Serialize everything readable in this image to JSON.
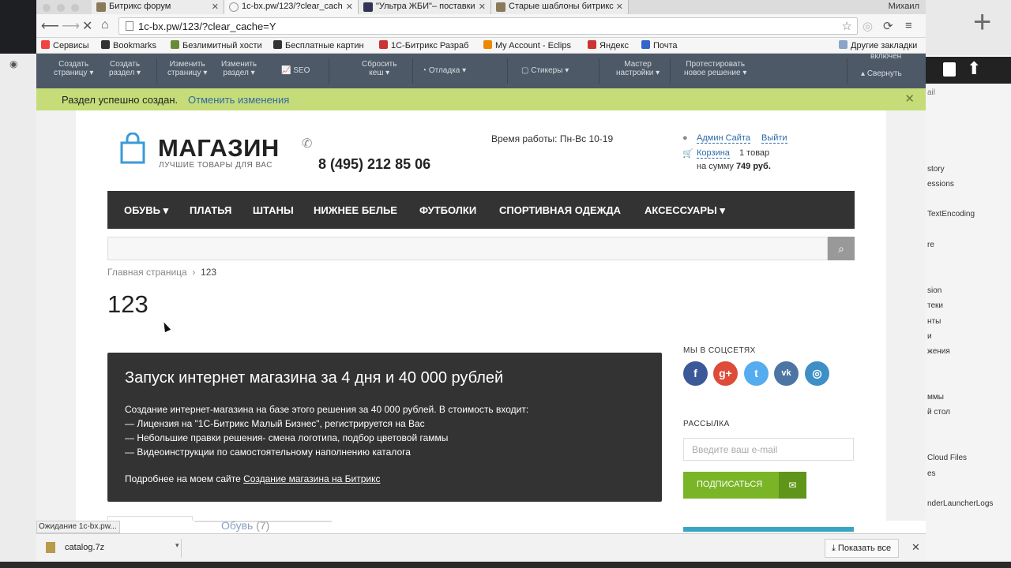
{
  "browser": {
    "profile": "Михаил",
    "tabs": [
      {
        "label": "Битрикс форум"
      },
      {
        "label": "1c-bx.pw/123/?clear_cach"
      },
      {
        "label": "\"Ультра ЖБИ\"– поставки"
      },
      {
        "label": "Старые шаблоны битрикс"
      }
    ],
    "url": "1c-bx.pw/123/?clear_cache=Y",
    "status": "Ожидание 1c-bx.pw...",
    "bookmarks": [
      {
        "label": "Сервисы",
        "color": "#e44"
      },
      {
        "label": "Bookmarks",
        "color": "#333"
      },
      {
        "label": "Безлимитный хости",
        "color": "#6a8a3a"
      },
      {
        "label": "Бесплатные картин",
        "color": "#333"
      },
      {
        "label": "1С-Битрикс Разраб",
        "color": "#c33"
      },
      {
        "label": "My Account - Eclips",
        "color": "#e80"
      },
      {
        "label": "Яндекс",
        "color": "#c33"
      },
      {
        "label": "Почта",
        "color": "#36c"
      }
    ],
    "other_bookmarks": "Другие закладки"
  },
  "admin_panel": {
    "items": [
      {
        "l1": "Создать",
        "l2": "страницу ▾"
      },
      {
        "l1": "Создать",
        "l2": "раздел ▾"
      },
      {
        "l1": "Изменить",
        "l2": "страницу ▾"
      },
      {
        "l1": "Изменить",
        "l2": "раздел ▾"
      },
      {
        "l1": "SEO"
      },
      {
        "l1": "Сбросить",
        "l2": "кеш ▾"
      },
      {
        "l1": "Отладка ▾"
      },
      {
        "l1": "Стикеры ▾"
      },
      {
        "l1": "Мастер",
        "l2": "настройки ▾"
      },
      {
        "l1": "Протестировать",
        "l2": "новое решение ▾"
      }
    ],
    "mode": "включен",
    "collapse": "Свернуть"
  },
  "notification": {
    "message": "Раздел успешно создан.",
    "undo": "Отменить изменения"
  },
  "store": {
    "logo_title": "МАГАЗИН",
    "logo_subtitle": "ЛУЧШИЕ ТОВАРЫ ДЛЯ ВАС",
    "phone": "8 (495) 212 85 06",
    "hours": "Время работы: Пн-Вс 10-19",
    "user": "Админ Сайта",
    "logout": "Выйти",
    "cart_label": "Корзина",
    "cart_count": "1 товар",
    "cart_sum_prefix": "на сумму",
    "cart_sum": "749 руб.",
    "menu": [
      "ОБУВЬ ▾",
      "ПЛАТЬЯ",
      "ШТАНЫ",
      "НИЖНЕЕ БЕЛЬЕ",
      "ФУТБОЛКИ",
      "СПОРТИВНАЯ ОДЕЖДА",
      "АКСЕССУАРЫ ▾"
    ],
    "breadcrumb_home": "Главная страница",
    "breadcrumb_current": "123",
    "page_title": "123",
    "promo": {
      "title": "Запуск интернет магазина за 4 дня и 40 000 рублей",
      "intro": "Создание интернет-магазина на базе этого решения за 40 000 рублей. В стоимость входит:",
      "items": [
        "— Лицензия на \"1С-Битрикс Малый Бизнес\", регистрируется на Вас",
        "— Небольшие правки решения- смена логотипа, подбор цветовой гаммы",
        "— Видеоинструкции по самостоятельному наполнению каталога"
      ],
      "more_prefix": "Подробнее на моем сайте",
      "more_link": "Создание магазина на Битрикс"
    },
    "category_link": "Обувь",
    "category_count": "(7)",
    "social_title": "МЫ В СОЦСЕТЯХ",
    "social": [
      {
        "name": "f",
        "color": "#3b5998"
      },
      {
        "name": "g+",
        "color": "#dd4b39"
      },
      {
        "name": "t",
        "color": "#55acee"
      },
      {
        "name": "vk",
        "color": "#4c75a3"
      },
      {
        "name": "ig",
        "color": "#3f8fc7"
      }
    ],
    "newsletter_title": "РАССЫЛКА",
    "email_placeholder": "Введите ваш e-mail",
    "subscribe": "ПОДПИСАТЬСЯ"
  },
  "downloads": {
    "file": "catalog.7z",
    "show_all": "Показать все"
  },
  "side_panel": {
    "items": [
      "story",
      "essions",
      "TextEncoding",
      "re",
      "sion",
      "теки",
      "нты",
      "и",
      "жения",
      "ммы",
      "й стол",
      "Cloud Files",
      "es",
      "nderLauncherLogs"
    ],
    "filter": "ail"
  }
}
